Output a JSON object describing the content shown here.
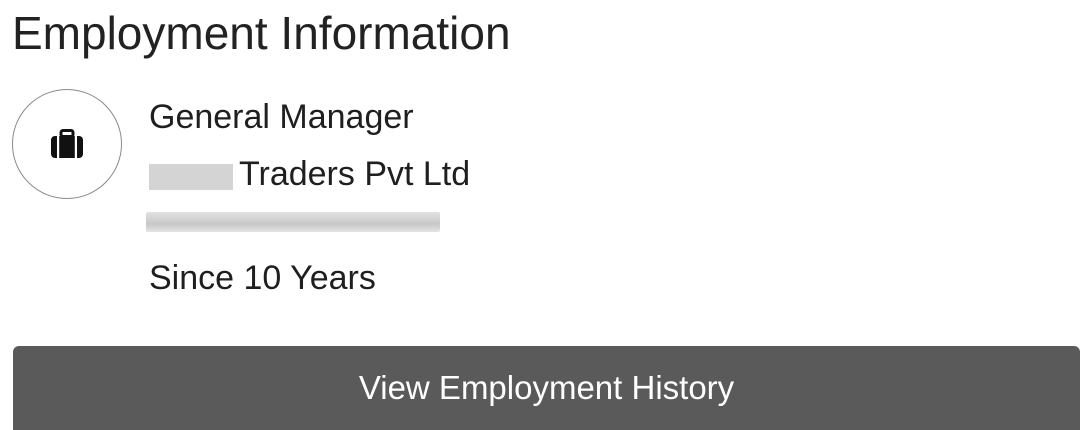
{
  "section": {
    "title": "Employment Information"
  },
  "employment": {
    "icon": "briefcase-icon",
    "designation": "General Manager",
    "company_suffix": "Traders Pvt Ltd",
    "duration": "Since 10 Years"
  },
  "actions": {
    "history_button_label": "View Employment History"
  },
  "colors": {
    "button_background": "#5a5a5a",
    "button_text": "#ffffff",
    "redaction": "#d4d4d4"
  }
}
